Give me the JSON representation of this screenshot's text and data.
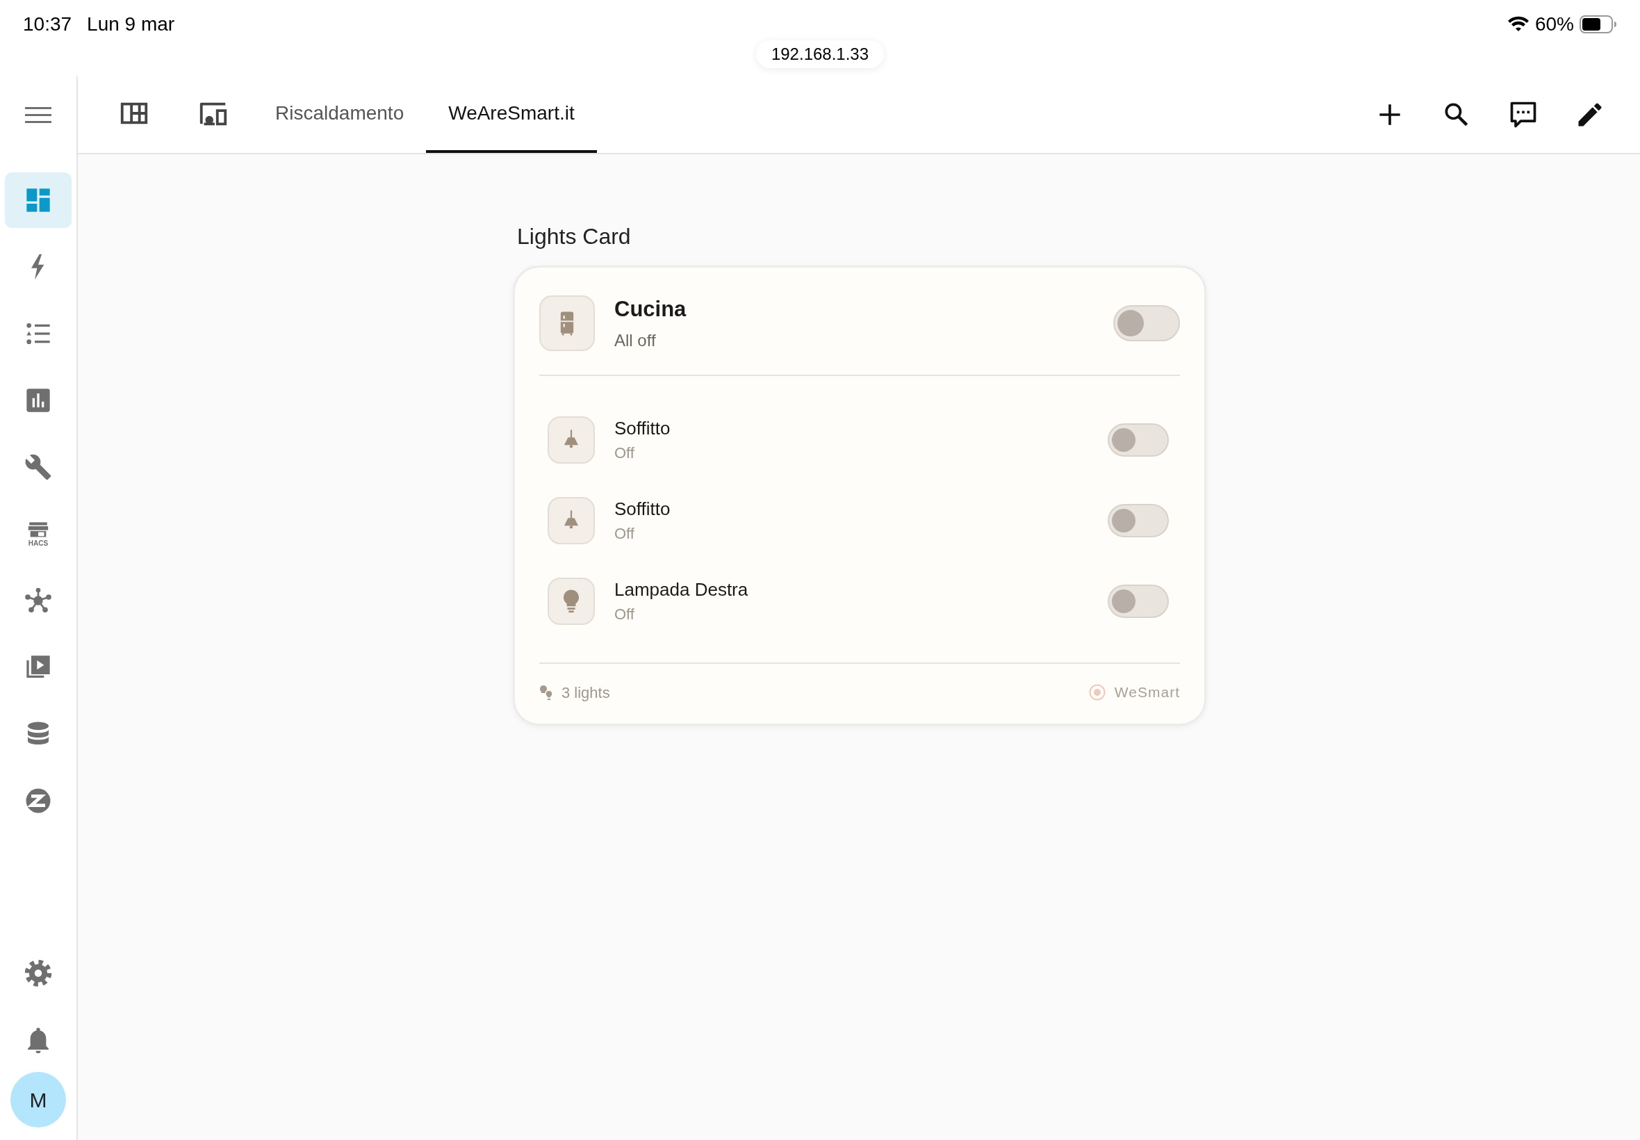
{
  "status_bar": {
    "time": "10:37",
    "date": "Lun 9 mar",
    "battery": "60%"
  },
  "address_bar": {
    "url": "192.168.1.33"
  },
  "tabs": [
    {
      "kind": "icon",
      "selected": false
    },
    {
      "kind": "icon",
      "selected": false
    },
    {
      "kind": "text",
      "label": "Riscaldamento",
      "selected": false
    },
    {
      "kind": "text",
      "label": "WeAreSmart.it",
      "selected": true
    }
  ],
  "sidebar": {
    "items": [
      {
        "selected": true
      },
      {
        "selected": false
      },
      {
        "selected": false
      },
      {
        "selected": false
      },
      {
        "selected": false
      },
      {
        "selected": false,
        "caption": "HACS"
      },
      {
        "selected": false
      },
      {
        "selected": false
      },
      {
        "selected": false
      },
      {
        "selected": false
      }
    ],
    "bottom_items": [
      {
        "selected": false
      },
      {
        "selected": false
      }
    ],
    "avatar": "M"
  },
  "card": {
    "title": "Lights Card",
    "group": {
      "name": "Cucina",
      "status": "All off",
      "on": false
    },
    "lights": [
      {
        "kind": "ceiling",
        "name": "Soffitto",
        "status": "Off",
        "on": false
      },
      {
        "kind": "ceiling",
        "name": "Soffitto",
        "status": "Off",
        "on": false
      },
      {
        "kind": "bulb",
        "name": "Lampada Destra",
        "status": "Off",
        "on": false
      }
    ],
    "footer": {
      "count": "3 lights",
      "brand": "WeSmart"
    }
  }
}
